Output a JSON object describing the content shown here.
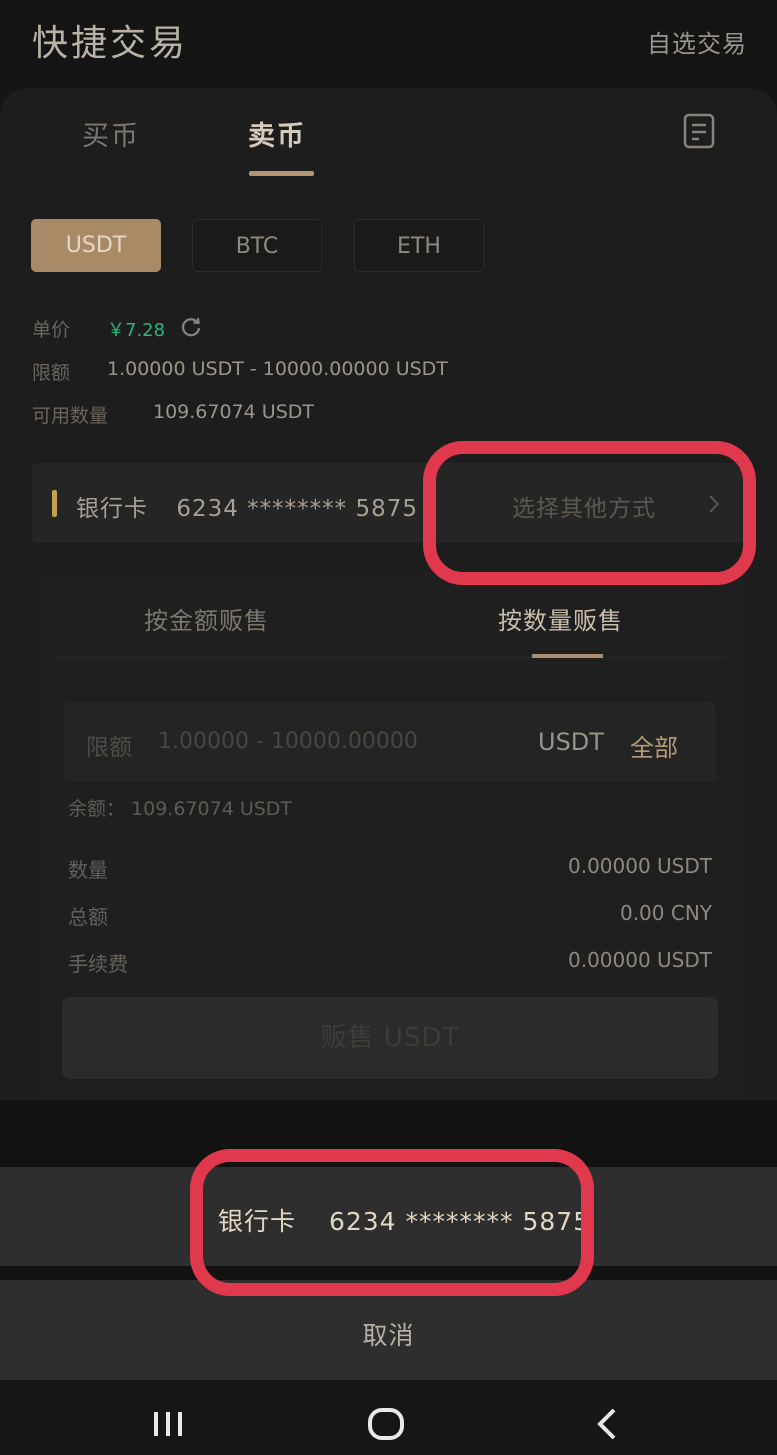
{
  "header": {
    "title": "快捷交易",
    "right_link": "自选交易"
  },
  "tabs": {
    "buy": "买币",
    "sell": "卖币"
  },
  "coins": {
    "usdt": "USDT",
    "btc": "BTC",
    "eth": "ETH",
    "selected": "USDT"
  },
  "info": {
    "price_label": "单价",
    "price_value": "￥7.28",
    "limit_label": "限额",
    "limit_value": "1.00000 USDT - 10000.00000 USDT",
    "available_label": "可用数量",
    "available_value": "109.67074 USDT"
  },
  "payment": {
    "method": "银行卡",
    "card": "6234 ******** 5875",
    "other": "选择其他方式"
  },
  "sell_form": {
    "tab_amount": "按金额贩售",
    "tab_quantity": "按数量贩售",
    "input_label": "限额",
    "input_placeholder": "1.00000 - 10000.00000",
    "input_unit": "USDT",
    "input_all": "全部",
    "balance": "余额：  109.67074 USDT",
    "quantity_label": "数量",
    "quantity_value": "0.00000 USDT",
    "total_label": "总额",
    "total_value": "0.00 CNY",
    "fee_label": "手续费",
    "fee_value": "0.00000 USDT",
    "sell_button": "贩售 USDT"
  },
  "action_sheet": {
    "option_method": "银行卡",
    "option_card": "6234 ******** 5875",
    "cancel": "取消"
  },
  "colors": {
    "accent": "#b49472",
    "price_green": "#2fb37a",
    "highlight": "#e0394d"
  },
  "icons": [
    "order-list-icon",
    "refresh-icon",
    "chevron-right-icon",
    "recents-icon",
    "home-icon",
    "back-icon"
  ]
}
